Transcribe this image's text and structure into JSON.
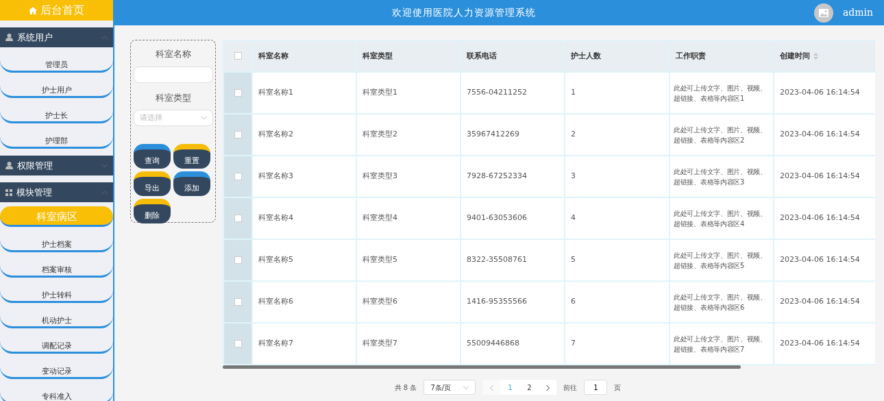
{
  "header": {
    "home": "后台首页",
    "title": "欢迎使用医院人力资源管理系统",
    "user": "admin"
  },
  "sidebar": {
    "groups": [
      {
        "label": "系统用户",
        "kind": "person",
        "expanded": true,
        "items": [
          {
            "label": "管理员",
            "selected": false
          },
          {
            "label": "护士用户",
            "selected": false
          },
          {
            "label": "护士长",
            "selected": false
          },
          {
            "label": "护理部",
            "selected": false
          }
        ]
      },
      {
        "label": "权限管理",
        "kind": "person",
        "expanded": false
      },
      {
        "label": "模块管理",
        "kind": "grid",
        "expanded": true,
        "items": [
          {
            "label": "科室病区",
            "selected": true
          },
          {
            "label": "护士档案",
            "selected": false
          },
          {
            "label": "档案审核",
            "selected": false
          },
          {
            "label": "护士转科",
            "selected": false
          },
          {
            "label": "机动护士",
            "selected": false
          },
          {
            "label": "调配记录",
            "selected": false
          },
          {
            "label": "变动记录",
            "selected": false
          },
          {
            "label": "专科准入",
            "selected": false
          }
        ]
      }
    ]
  },
  "search": {
    "fields": [
      {
        "label": "科室名称",
        "kind": "text"
      },
      {
        "label": "科室类型",
        "kind": "select",
        "placeholder": "请选择"
      }
    ],
    "buttons": [
      {
        "label": "查询",
        "color": "#2b8fdc"
      },
      {
        "label": "重置",
        "color": "#f5bd0a"
      },
      {
        "label": "导出",
        "color": "#f5bd0a"
      },
      {
        "label": "添加",
        "color": "#2b8fdc"
      },
      {
        "label": "删除",
        "color": "#f5bd0a"
      }
    ]
  },
  "table": {
    "all_checked": false,
    "columns": [
      {
        "label": "科室名称",
        "sortable": false
      },
      {
        "label": "科室类型",
        "sortable": false
      },
      {
        "label": "联系电话",
        "sortable": false
      },
      {
        "label": "护士人数",
        "sortable": false
      },
      {
        "label": "工作职责",
        "sortable": false
      },
      {
        "label": "创建时间",
        "sortable": true
      }
    ],
    "rows": [
      {
        "checked": false,
        "cells": [
          "科室名称1",
          "科室类型1",
          "7556-04211252",
          "1",
          "此处可上传文字、图片、视频、超链接、表格等内容区1",
          "2023-04-06 16:14:54"
        ]
      },
      {
        "checked": false,
        "cells": [
          "科室名称2",
          "科室类型2",
          "35967412269",
          "2",
          "此处可上传文字、图片、视频、超链接、表格等内容区2",
          "2023-04-06 16:14:54"
        ]
      },
      {
        "checked": false,
        "cells": [
          "科室名称3",
          "科室类型3",
          "7928-67252334",
          "3",
          "此处可上传文字、图片、视频、超链接、表格等内容区3",
          "2023-04-06 16:14:54"
        ]
      },
      {
        "checked": false,
        "cells": [
          "科室名称4",
          "科室类型4",
          "9401-63053606",
          "4",
          "此处可上传文字、图片、视频、超链接、表格等内容区4",
          "2023-04-06 16:14:54"
        ]
      },
      {
        "checked": false,
        "cells": [
          "科室名称5",
          "科室类型5",
          "8322-35508761",
          "5",
          "此处可上传文字、图片、视频、超链接、表格等内容区5",
          "2023-04-06 16:14:54"
        ]
      },
      {
        "checked": false,
        "cells": [
          "科室名称6",
          "科室类型6",
          "1416-95355566",
          "6",
          "此处可上传文字、图片、视频、超链接、表格等内容区6",
          "2023-04-06 16:14:54"
        ]
      },
      {
        "checked": false,
        "cells": [
          "科室名称7",
          "科室类型7",
          "55009446868",
          "7",
          "此处可上传文字、图片、视频、超链接、表格等内容区7",
          "2023-04-06 16:14:54"
        ]
      }
    ]
  },
  "pagination": {
    "total": "共 8 条",
    "page_size": "7条/页",
    "pages": [
      {
        "label": "1",
        "selected": true
      },
      {
        "label": "2",
        "selected": false
      }
    ],
    "goto_label": "前往",
    "goto_value": "1",
    "goto_suffix": "页"
  }
}
